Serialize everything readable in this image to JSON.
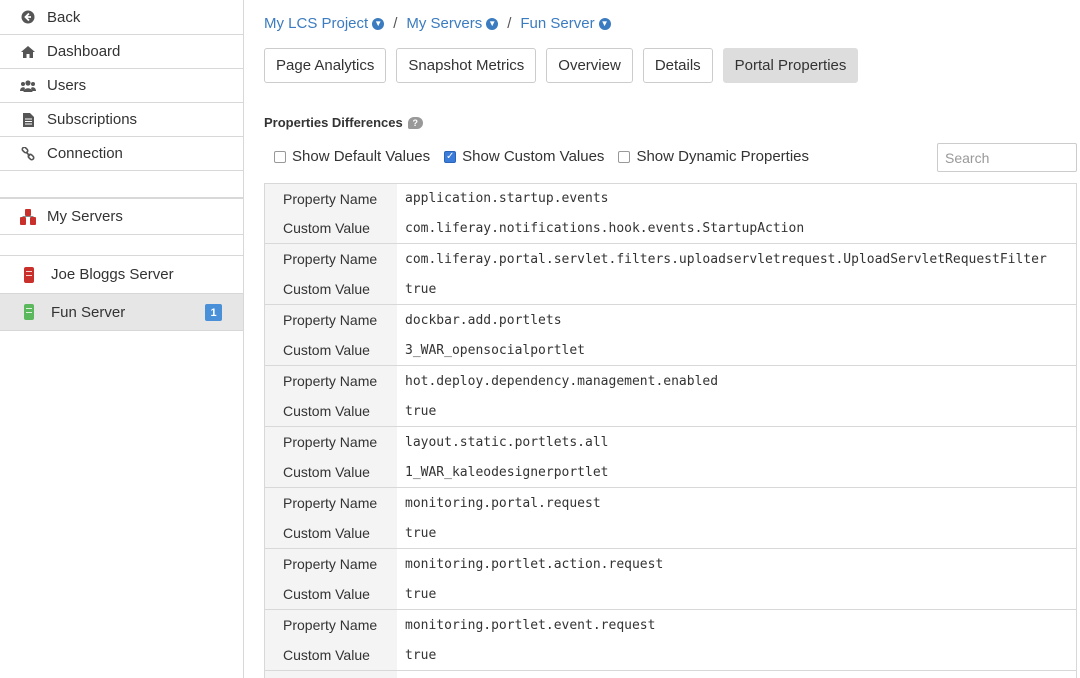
{
  "sidebar": {
    "nav": [
      {
        "label": "Back",
        "icon": "back-arrow-icon"
      },
      {
        "label": "Dashboard",
        "icon": "home-icon"
      },
      {
        "label": "Users",
        "icon": "users-icon"
      },
      {
        "label": "Subscriptions",
        "icon": "document-icon"
      },
      {
        "label": "Connection",
        "icon": "link-icon"
      }
    ],
    "my_servers_label": "My Servers",
    "servers": [
      {
        "label": "Joe Bloggs Server",
        "color": "#c9302c"
      },
      {
        "label": "Fun Server",
        "color": "#5cb85c",
        "badge": "1"
      }
    ]
  },
  "breadcrumb": [
    "My LCS Project",
    "My Servers",
    "Fun Server"
  ],
  "tabs": [
    "Page Analytics",
    "Snapshot Metrics",
    "Overview",
    "Details",
    "Portal Properties"
  ],
  "section_title": "Properties Differences",
  "filters": [
    {
      "label": "Show Default Values",
      "checked": false
    },
    {
      "label": "Show Custom Values",
      "checked": true
    },
    {
      "label": "Show Dynamic Properties",
      "checked": false
    }
  ],
  "search": {
    "placeholder": "Search"
  },
  "table": {
    "name_label": "Property Name",
    "value_label": "Custom Value",
    "rows": [
      {
        "name": "application.startup.events",
        "value": "com.liferay.notifications.hook.events.StartupAction"
      },
      {
        "name": "com.liferay.portal.servlet.filters.uploadservletrequest.UploadServletRequestFilter",
        "value": "true"
      },
      {
        "name": "dockbar.add.portlets",
        "value": "3_WAR_opensocialportlet"
      },
      {
        "name": "hot.deploy.dependency.management.enabled",
        "value": "true"
      },
      {
        "name": "layout.static.portlets.all",
        "value": "1_WAR_kaleodesignerportlet"
      },
      {
        "name": "monitoring.portal.request",
        "value": "true"
      },
      {
        "name": "monitoring.portlet.action.request",
        "value": "true"
      },
      {
        "name": "monitoring.portlet.event.request",
        "value": "true"
      }
    ]
  },
  "colors": {
    "accent": "#3b7bbf",
    "badge": "#4a90d9"
  }
}
